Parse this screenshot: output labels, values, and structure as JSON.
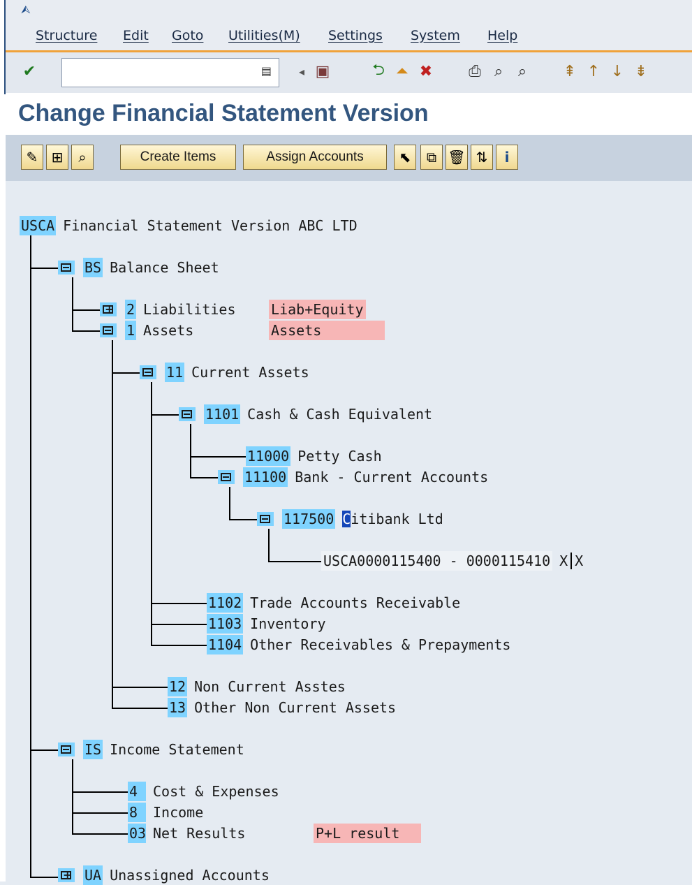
{
  "menu": {
    "items": [
      "Structure",
      "Edit",
      "Goto",
      "Utilities(M)",
      "Settings",
      "System",
      "Help"
    ]
  },
  "toolbar": {
    "command_value": ""
  },
  "page": {
    "title": "Change Financial Statement Version"
  },
  "app_toolbar": {
    "create_items": "Create Items",
    "assign_accounts": "Assign Accounts"
  },
  "tree": {
    "root": {
      "key": "USCA",
      "text": "Financial Statement Version ABC LTD"
    },
    "bs": {
      "key": "BS",
      "text": "Balance Sheet"
    },
    "liab": {
      "key": "2",
      "text": "Liabilities",
      "tag": "Liab+Equity"
    },
    "assets": {
      "key": "1",
      "text": "Assets",
      "tag": "Assets"
    },
    "ca": {
      "key": "11",
      "text": "Current Assets"
    },
    "cash": {
      "key": "1101",
      "text": "Cash & Cash Equivalent"
    },
    "petty": {
      "key": "11000",
      "text": "Petty Cash"
    },
    "bank": {
      "key": "11100",
      "text": "Bank - Current Accounts"
    },
    "citi": {
      "key": "117500",
      "text_first": "C",
      "text_rest": "itibank Ltd"
    },
    "range": {
      "text": "USCA0000115400 - 0000115410",
      "flag1": "X",
      "flag2": "X"
    },
    "trade": {
      "key": "1102",
      "text": "Trade Accounts Receivable"
    },
    "inv": {
      "key": "1103",
      "text": "Inventory"
    },
    "other_rec": {
      "key": "1104",
      "text": "Other Receivables & Prepayments"
    },
    "nca": {
      "key": "12",
      "text": "Non Current Asstes"
    },
    "onca": {
      "key": "13",
      "text": "Other Non Current Assets"
    },
    "is": {
      "key": "IS",
      "text": "Income Statement"
    },
    "cost": {
      "key": "4",
      "text": "Cost & Expenses"
    },
    "income": {
      "key": "8",
      "text": "Income"
    },
    "net": {
      "key": "03",
      "text": "Net Results",
      "tag": "P+L result"
    },
    "ua": {
      "key": "UA",
      "text": "Unassigned Accounts"
    }
  }
}
